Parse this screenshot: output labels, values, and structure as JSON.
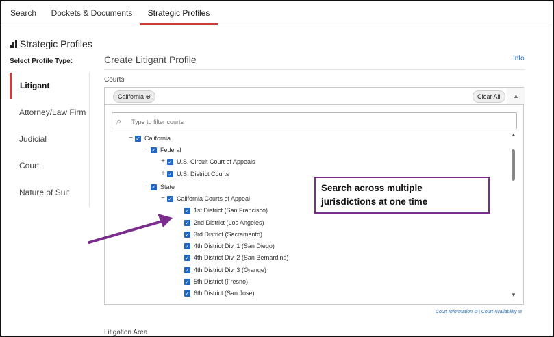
{
  "tabs": [
    {
      "label": "Search",
      "active": false
    },
    {
      "label": "Dockets & Documents",
      "active": false
    },
    {
      "label": "Strategic Profiles",
      "active": true
    }
  ],
  "sidebar": {
    "title": "Strategic Profiles",
    "section_label": "Select Profile Type:",
    "items": [
      {
        "label": "Litigant",
        "active": true
      },
      {
        "label": "Attorney/Law Firm",
        "active": false
      },
      {
        "label": "Judicial",
        "active": false
      },
      {
        "label": "Court",
        "active": false
      },
      {
        "label": "Nature of Suit",
        "active": false
      }
    ]
  },
  "main": {
    "title": "Create Litigant Profile",
    "info_link": "Info",
    "courts_label": "Courts",
    "selected_chip": "California ⊗",
    "clear_all": "Clear All",
    "filter_placeholder": "Type to filter courts",
    "tree": [
      {
        "label": "California",
        "toggle": "−",
        "level": 0
      },
      {
        "label": "Federal",
        "toggle": "−",
        "level": 1
      },
      {
        "label": "U.S. Circuit Court of Appeals",
        "toggle": "+",
        "level": 2
      },
      {
        "label": "U.S. District Courts",
        "toggle": "+",
        "level": 2
      },
      {
        "label": "State",
        "toggle": "−",
        "level": 1
      },
      {
        "label": "California Courts of Appeal",
        "toggle": "−",
        "level": 2
      },
      {
        "label": "1st District (San Francisco)",
        "toggle": "",
        "level": 3
      },
      {
        "label": "2nd District (Los Angeles)",
        "toggle": "",
        "level": 3
      },
      {
        "label": "3rd District (Sacramento)",
        "toggle": "",
        "level": 3
      },
      {
        "label": "4th District Div. 1 (San Diego)",
        "toggle": "",
        "level": 3
      },
      {
        "label": "4th District Div. 2 (San Bernardino)",
        "toggle": "",
        "level": 3
      },
      {
        "label": "4th District Div. 3 (Orange)",
        "toggle": "",
        "level": 3
      },
      {
        "label": "5th District (Fresno)",
        "toggle": "",
        "level": 3
      },
      {
        "label": "6th District (San Jose)",
        "toggle": "",
        "level": 3
      }
    ],
    "footer_links": [
      "Court Information",
      "Court Availability"
    ],
    "litigation_area_label": "Litigation Area"
  },
  "callout": {
    "line1": "Search across multiple",
    "line2": "jurisdictions at one time"
  },
  "colors": {
    "accent": "#d23a3a",
    "checkbox": "#1f66c7",
    "link": "#2a6ebb",
    "callout_border": "#7b2d8e"
  }
}
